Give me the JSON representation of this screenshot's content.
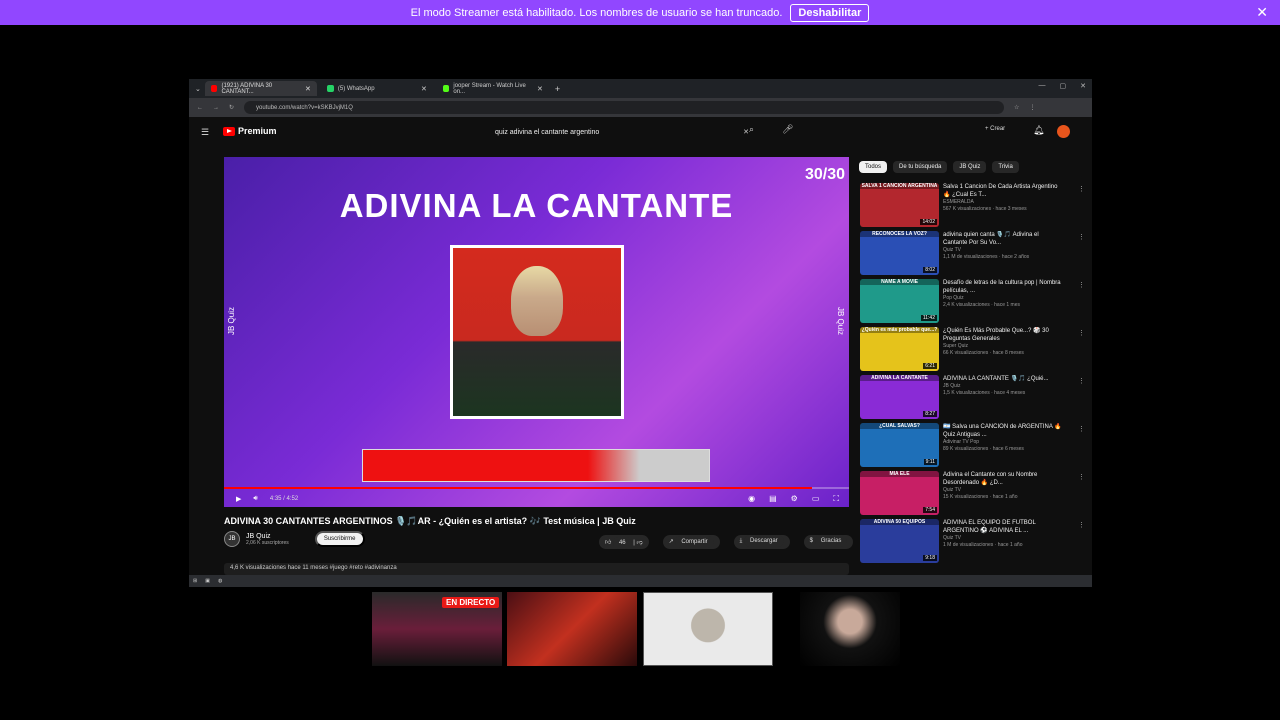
{
  "banner": {
    "text": "El modo Streamer está habilitado. Los nombres de usuario se han truncado.",
    "button": "Deshabilitar"
  },
  "browser": {
    "tabs": [
      {
        "label": "(1921) ADIVINA 30 CANTANT...",
        "color": "#ff0000"
      },
      {
        "label": "(5) WhatsApp",
        "color": "#25d366"
      },
      {
        "label": "jooper Stream - Watch Live on...",
        "color": "#53fc18"
      }
    ],
    "url": "youtube.com/watch?v=kSKBJvjM1Q"
  },
  "youtube": {
    "logo": "Premium",
    "search_query": "quiz adivina el cantante argentino",
    "create_label": "Crear",
    "notifications": "9+"
  },
  "player": {
    "title": "ADIVINA LA CANTANTE",
    "counter": "30/30",
    "brand": "JB Quiz",
    "time": "4:35 / 4:52",
    "progress": 0.94
  },
  "video": {
    "title": "ADIVINA 30 CANTANTES ARGENTINOS 🎙️🎵AR - ¿Quién es el artista? 🎶 Test música | JB Quiz",
    "channel": "JB Quiz",
    "subscribers": "2,06 K suscriptores",
    "subscribe": "Suscribirme",
    "likes": "46",
    "share": "Compartir",
    "download": "Descargar",
    "thanks": "Gracias",
    "description": "4,6 K visualizaciones  hace 11 meses  #juego #reto #adivinanza"
  },
  "chips": [
    "Todos",
    "De tu búsqueda",
    "JB Quiz",
    "Trivia"
  ],
  "recommendations": [
    {
      "title": "Salva 1 Cancion De Cada Artista Argentino 🔥 ¿Cual Es T...",
      "channel": "ESMERALDA",
      "meta": "567 K visualizaciones · hace 3 meses",
      "dur": "14:02",
      "cap": "SALVA 1 CANCION ARGENTINA",
      "color": "#b3272e"
    },
    {
      "title": "adivina quien canta 🎙️🎵 Adivina el Cantante Por Su Vo...",
      "channel": "Quiz TV",
      "meta": "1,1 M de visualizaciones · hace 2 años",
      "dur": "8:02",
      "cap": "RECONOCES LA VOZ?",
      "color": "#2a4fb5"
    },
    {
      "title": "Desafío de letras de la cultura pop | Nombra películas, ...",
      "channel": "Pop Quiz",
      "meta": "2,4 K visualizaciones · hace 1 mes",
      "dur": "11:42",
      "cap": "NAME A MOVIE",
      "color": "#1f9a8a"
    },
    {
      "title": "¿Quién Es Más Probable Que...? 🎲 30 Preguntas Generales",
      "channel": "Super Quiz",
      "meta": "66 K visualizaciones · hace 8 meses",
      "dur": "6:21",
      "cap": "¿Quién es más probable que...?",
      "color": "#e5c31b"
    },
    {
      "title": "ADIVINA LA CANTANTE 🎙️🎵 ¿Quié...",
      "channel": "JB Quiz",
      "meta": "1,5 K visualizaciones · hace 4 meses",
      "dur": "8:27",
      "cap": "ADIVINA LA CANTANTE",
      "color": "#8a2bd6"
    },
    {
      "title": "🇦🇷 Salva una CANCIÓN de ARGENTINA 🔥 Quiz Antiguas ...",
      "channel": "Adivinar TV Pop",
      "meta": "89 K visualizaciones · hace 6 meses",
      "dur": "9:11",
      "cap": "¿CUÁL SALVAS?",
      "color": "#1e6fb8"
    },
    {
      "title": "Adivina el Cantante con su Nombre Desordenado 🔥 ¿D...",
      "channel": "Quiz TV",
      "meta": "15 K visualizaciones · hace 1 año",
      "dur": "7:54",
      "cap": "MIA ELE",
      "color": "#c71f65"
    },
    {
      "title": "ADIVINA EL EQUIPO DE FUTBOL ARGENTINO ⚽ ADIVINA EL ...",
      "channel": "Quiz TV",
      "meta": "1 M de visualizaciones · hace 1 año",
      "dur": "9:18",
      "cap": "ADIVINA 50 EQUIPOS",
      "color": "#2a3d9c"
    }
  ],
  "stream": {
    "live_badge": "EN DIRECTO"
  }
}
